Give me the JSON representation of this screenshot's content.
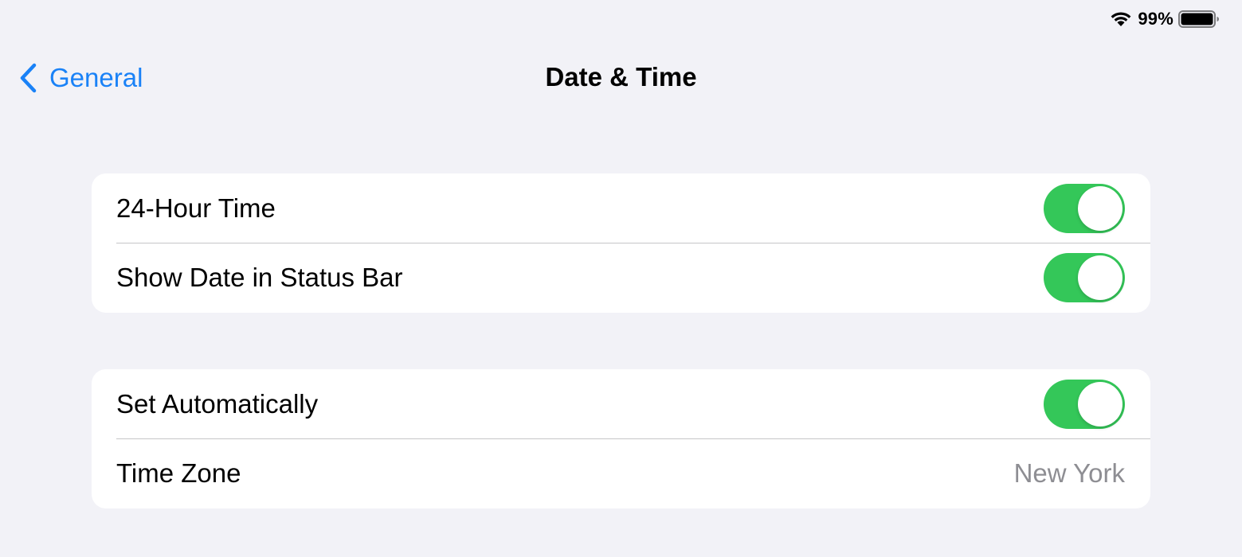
{
  "status_bar": {
    "battery_percent": "99%",
    "wifi_icon": "wifi-icon",
    "battery_icon": "battery-icon"
  },
  "nav": {
    "back_label": "General",
    "back_icon": "chevron-left-icon",
    "title": "Date & Time"
  },
  "colors": {
    "accent": "#1a82f7",
    "toggle_on": "#34c759",
    "background": "#f2f2f7",
    "secondary_text": "#8e8e93"
  },
  "groups": [
    {
      "rows": [
        {
          "label": "24-Hour Time",
          "toggle": true
        },
        {
          "label": "Show Date in Status Bar",
          "toggle": true
        }
      ]
    },
    {
      "rows": [
        {
          "label": "Set Automatically",
          "toggle": true
        },
        {
          "label": "Time Zone",
          "value": "New York"
        }
      ]
    }
  ]
}
